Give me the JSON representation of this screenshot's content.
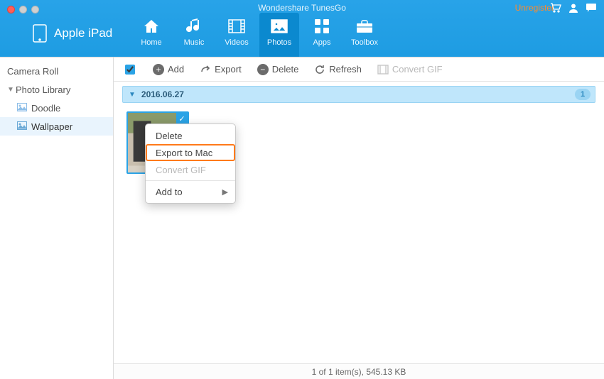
{
  "window": {
    "title": "Wondershare TunesGo",
    "unregister": "Unregister"
  },
  "device": {
    "name": "Apple iPad"
  },
  "nav": {
    "home": "Home",
    "music": "Music",
    "videos": "Videos",
    "photos": "Photos",
    "apps": "Apps",
    "toolbox": "Toolbox"
  },
  "sidebar": {
    "camera_roll": "Camera Roll",
    "photo_library": "Photo Library",
    "doodle": "Doodle",
    "wallpaper": "Wallpaper"
  },
  "toolbar": {
    "add": "Add",
    "export": "Export",
    "delete": "Delete",
    "refresh": "Refresh",
    "convert_gif": "Convert GIF"
  },
  "group": {
    "date": "2016.06.27",
    "count": "1"
  },
  "context_menu": {
    "delete": "Delete",
    "export_mac": "Export to Mac",
    "convert_gif": "Convert GIF",
    "add_to": "Add to"
  },
  "status": {
    "text": "1 of 1 item(s), 545.13 KB"
  }
}
